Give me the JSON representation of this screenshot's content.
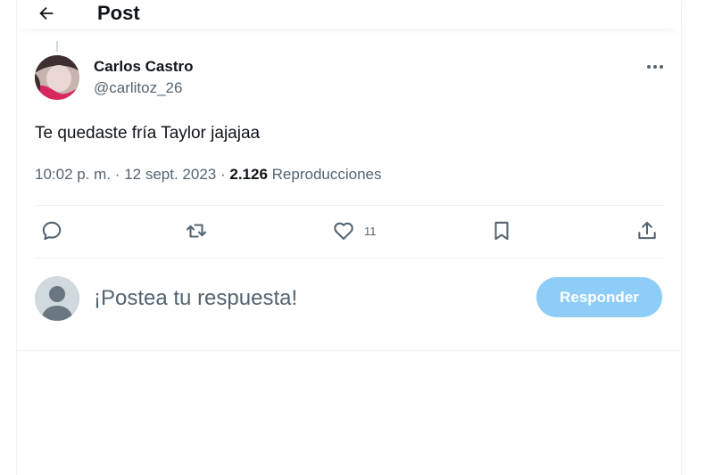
{
  "header": {
    "title": "Post",
    "back_icon": "arrow-left-icon"
  },
  "post": {
    "author_name": "Carlos Castro",
    "author_handle": "@carlitoz_26",
    "text": "Te quedaste fría Taylor jajajaa",
    "time": "10:02 p. m.",
    "date": "12 sept. 2023",
    "separator": "·",
    "views_count": "2.126",
    "views_label": "Reproducciones",
    "more_icon": "more-horizontal-icon"
  },
  "actions": {
    "reply_icon": "reply-bubble-icon",
    "repost_icon": "repost-icon",
    "like_icon": "heart-icon",
    "like_count": "11",
    "bookmark_icon": "bookmark-icon",
    "share_icon": "share-upload-icon"
  },
  "composer": {
    "placeholder": "¡Postea tu respuesta!",
    "button_label": "Responder",
    "button_color": "#8ecdf8"
  },
  "colors": {
    "text_primary": "#0f1419",
    "text_secondary": "#536471",
    "divider": "#eff3f4"
  }
}
